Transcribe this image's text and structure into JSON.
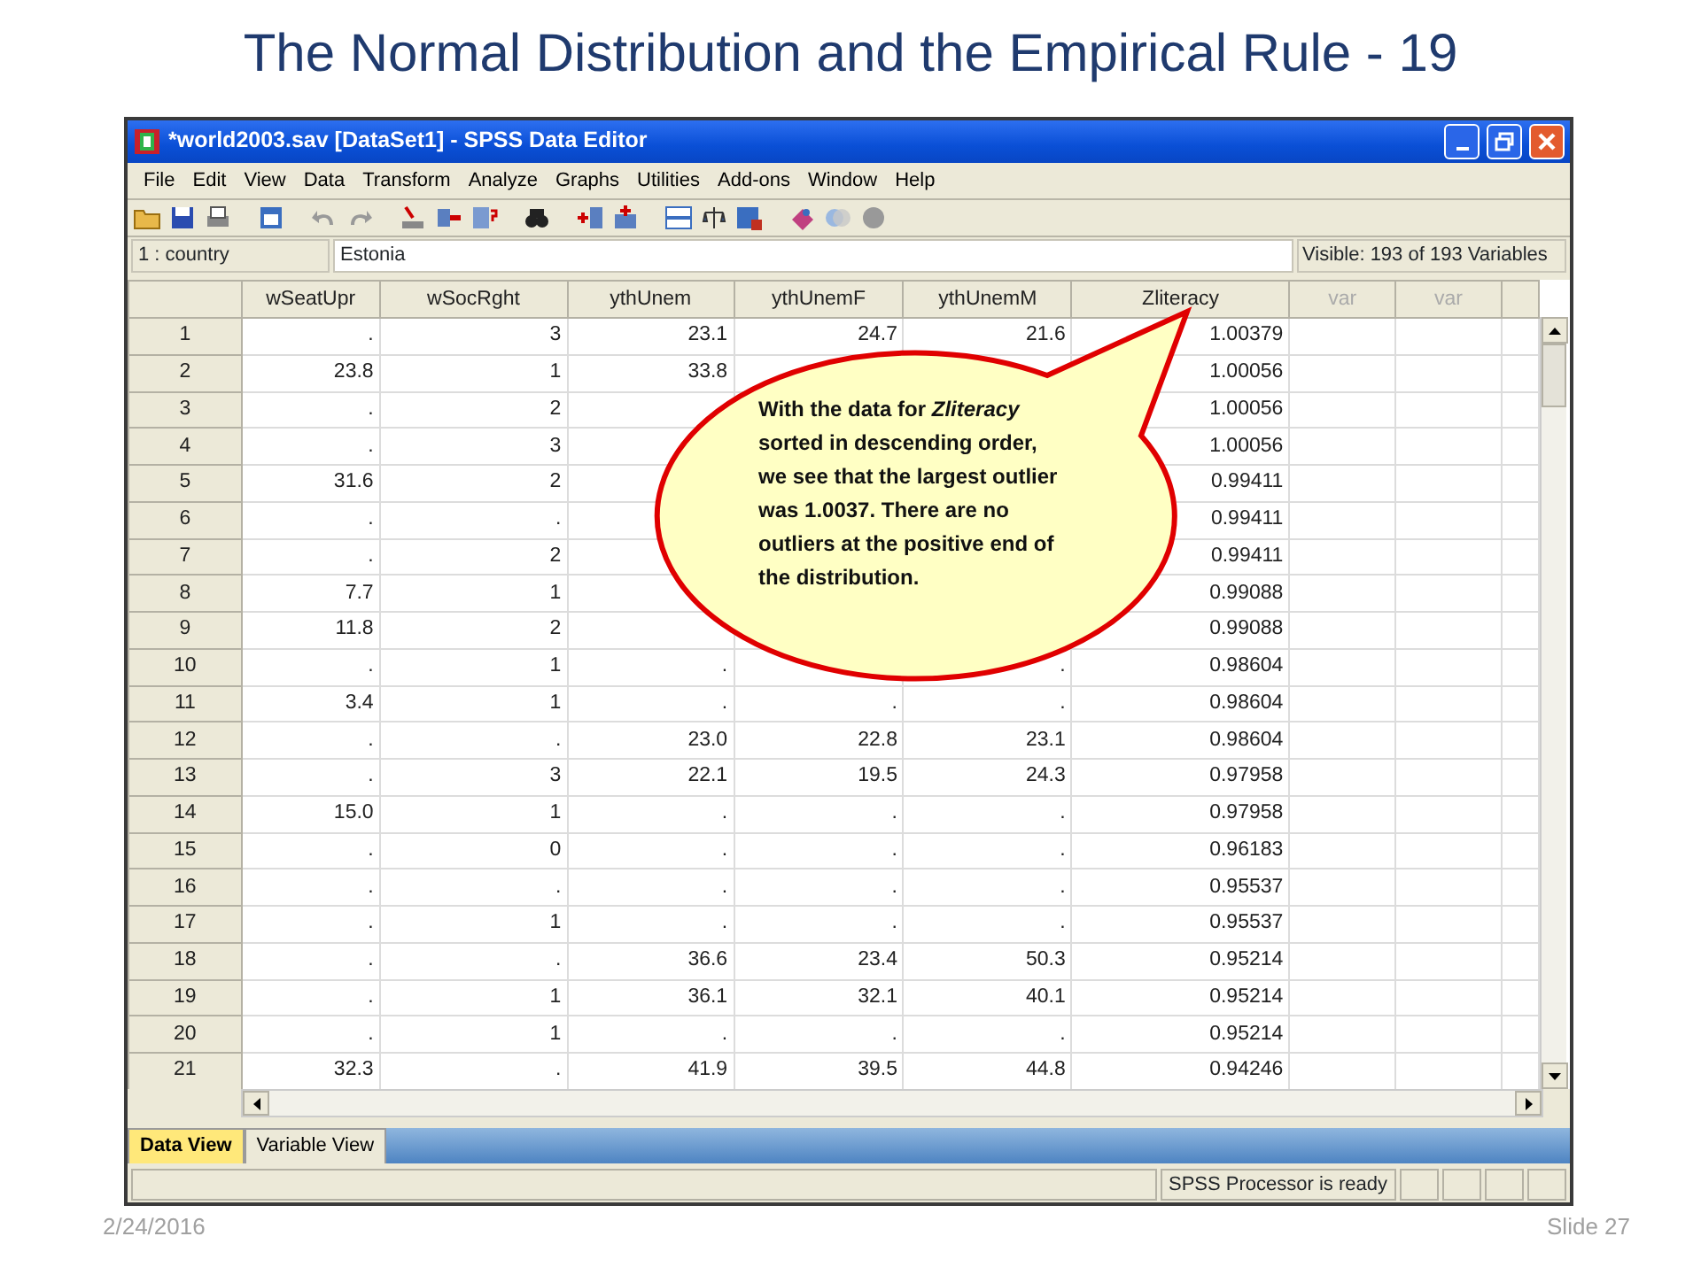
{
  "slide": {
    "title": "The Normal Distribution and the Empirical Rule -  19",
    "date": "2/24/2016",
    "slide_number": "Slide 27"
  },
  "window": {
    "title": "*world2003.sav [DataSet1] - SPSS Data Editor"
  },
  "menu": [
    "File",
    "Edit",
    "View",
    "Data",
    "Transform",
    "Analyze",
    "Graphs",
    "Utilities",
    "Add-ons",
    "Window",
    "Help"
  ],
  "cell_editor": {
    "reference": "1 : country",
    "value": "Estonia",
    "visible_count": "Visible: 193 of 193 Variables"
  },
  "table": {
    "columns": [
      {
        "label": "wSeatUpr",
        "defined": true
      },
      {
        "label": "wSocRght",
        "defined": true
      },
      {
        "label": "ythUnem",
        "defined": true
      },
      {
        "label": "ythUnemF",
        "defined": true
      },
      {
        "label": "ythUnemM",
        "defined": true
      },
      {
        "label": "Zliteracy",
        "defined": true
      },
      {
        "label": "var",
        "defined": false
      },
      {
        "label": "var",
        "defined": false
      }
    ],
    "rows": [
      {
        "number": "1",
        "cells": [
          ".",
          "3",
          "23.1",
          "24.7",
          "21.6",
          "1.00379"
        ]
      },
      {
        "number": "2",
        "cells": [
          "23.8",
          "1",
          "33.8",
          null,
          null,
          "1.00056"
        ]
      },
      {
        "number": "3",
        "cells": [
          ".",
          "2",
          null,
          null,
          null,
          "1.00056"
        ]
      },
      {
        "number": "4",
        "cells": [
          ".",
          "3",
          null,
          null,
          null,
          "1.00056"
        ]
      },
      {
        "number": "5",
        "cells": [
          "31.6",
          "2",
          null,
          null,
          null,
          "0.99411"
        ]
      },
      {
        "number": "6",
        "cells": [
          ".",
          ".",
          null,
          null,
          null,
          "0.99411"
        ]
      },
      {
        "number": "7",
        "cells": [
          ".",
          "2",
          null,
          null,
          null,
          "0.99411"
        ]
      },
      {
        "number": "8",
        "cells": [
          "7.7",
          "1",
          null,
          null,
          null,
          "0.99088"
        ]
      },
      {
        "number": "9",
        "cells": [
          "11.8",
          "2",
          null,
          null,
          null,
          "0.99088"
        ]
      },
      {
        "number": "10",
        "cells": [
          ".",
          "1",
          ".",
          null,
          ".",
          "0.98604"
        ]
      },
      {
        "number": "11",
        "cells": [
          "3.4",
          "1",
          ".",
          ".",
          ".",
          "0.98604"
        ]
      },
      {
        "number": "12",
        "cells": [
          ".",
          ".",
          "23.0",
          "22.8",
          "23.1",
          "0.98604"
        ]
      },
      {
        "number": "13",
        "cells": [
          ".",
          "3",
          "22.1",
          "19.5",
          "24.3",
          "0.97958"
        ]
      },
      {
        "number": "14",
        "cells": [
          "15.0",
          "1",
          ".",
          ".",
          ".",
          "0.97958"
        ]
      },
      {
        "number": "15",
        "cells": [
          ".",
          "0",
          ".",
          ".",
          ".",
          "0.96183"
        ]
      },
      {
        "number": "16",
        "cells": [
          ".",
          ".",
          ".",
          ".",
          ".",
          "0.95537"
        ]
      },
      {
        "number": "17",
        "cells": [
          ".",
          "1",
          ".",
          ".",
          ".",
          "0.95537"
        ]
      },
      {
        "number": "18",
        "cells": [
          ".",
          ".",
          "36.6",
          "23.4",
          "50.3",
          "0.95214"
        ]
      },
      {
        "number": "19",
        "cells": [
          ".",
          "1",
          "36.1",
          "32.1",
          "40.1",
          "0.95214"
        ]
      },
      {
        "number": "20",
        "cells": [
          ".",
          "1",
          ".",
          ".",
          ".",
          "0.95214"
        ]
      },
      {
        "number": "21",
        "cells": [
          "32.3",
          ".",
          "41.9",
          "39.5",
          "44.8",
          "0.94246"
        ]
      }
    ]
  },
  "callout": {
    "text": "With the data for *Zliteracy* sorted in descending order, we see that the largest outlier was 1.0037.  There are no outliers at the positive end of the distribution."
  },
  "tabs": [
    {
      "label": "Data View",
      "selected": true
    },
    {
      "label": "Variable View",
      "selected": false
    }
  ],
  "status_bar": {
    "text": "SPSS  Processor is ready"
  }
}
